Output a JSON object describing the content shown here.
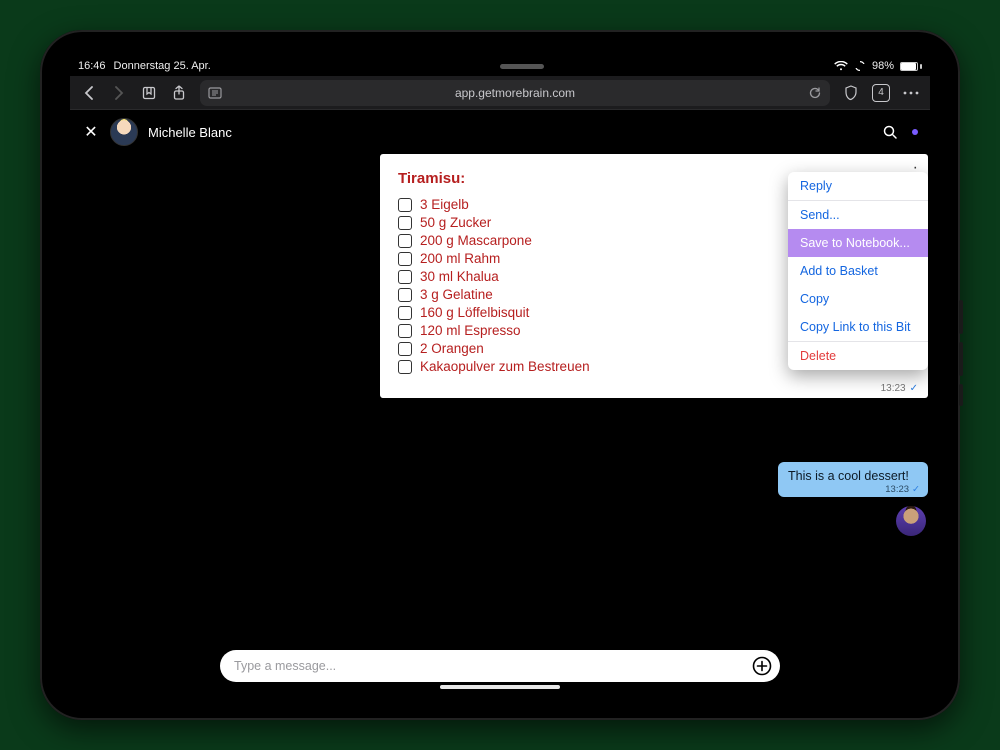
{
  "status": {
    "time": "16:46",
    "date": "Donnerstag 25. Apr.",
    "battery_pct": "98%"
  },
  "browser": {
    "url": "app.getmorebrain.com",
    "tab_count": "4"
  },
  "header": {
    "contact_name": "Michelle Blanc"
  },
  "card": {
    "title": "Tiramisu:",
    "timestamp": "13:23",
    "ingredients": [
      "3 Eigelb",
      "50 g Zucker",
      "200 g Mascarpone",
      "200 ml Rahm",
      "30 ml Khalua",
      "3 g Gelatine",
      "160 g Löffelbisquit",
      "120 ml Espresso",
      "2 Orangen",
      "Kakaopulver zum Bestreuen"
    ]
  },
  "context_menu": {
    "items": [
      "Reply",
      "Send...",
      "Save to Notebook...",
      "Add to Basket",
      "Copy",
      "Copy Link to this Bit",
      "Delete"
    ],
    "selected_index": 2
  },
  "bubble": {
    "text": "This is a cool dessert!",
    "timestamp": "13:23"
  },
  "composer": {
    "placeholder": "Type a message..."
  }
}
